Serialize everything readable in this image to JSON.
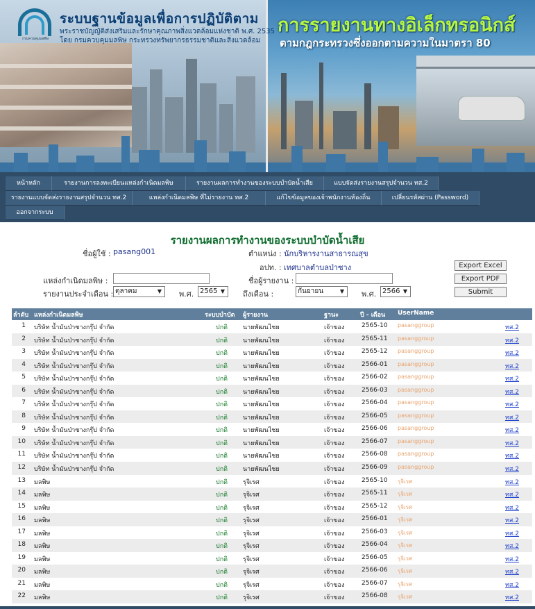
{
  "banner": {
    "org_title": "ระบบฐานข้อมูลเพื่อการปฏิบัติตาม",
    "org_sub1": "พระราชบัญญัติส่งเสริมและรักษาคุณภาพสิ่งแวดล้อมแห่งชาติ พ.ศ. 2535",
    "org_sub2": "โดย กรมควบคุมมลพิษ กระทรวงทรัพยากรธรรมชาติและสิ่งแวดล้อม",
    "logo_caption": "กรมควบคุมมลพิษ",
    "e_title": "การรายงานทางอิเล็กทรอนิกส์",
    "e_subtitle": "ตามกฎกระทรวงซึ่งออกตามความในมาตรา 80"
  },
  "menu": {
    "row1": [
      "หน้าหลัก",
      "รายงานการลงทะเบียนแหล่งกำเนิดมลพิษ",
      "รายงานผลการทำงานของระบบบำบัดน้ำเสีย",
      "แบบจัดส่งรายงานสรุปจำนวน ทส.2"
    ],
    "row2": [
      "รายงานแบบจัดส่งรายงานสรุปจำนวน ทส.2",
      "แหล่งกำเนิดมลพิษ ที่ไม่รายงาน ทส.2",
      "แก้ไขข้อมูลของเจ้าพนักงานท้องถิ่น",
      "เปลี่ยนรหัสผ่าน (Password)"
    ],
    "row3": [
      "ออกจากระบบ"
    ]
  },
  "report": {
    "title": "รายงานผลการทำงานของระบบบำบัดน้ำเสีย",
    "user_label": "ชื่อผู้ใช้ :",
    "user_value": "pasang001",
    "position_label": "ตำแหน่ง :",
    "position_value": "นักบริหารงานสาธารณสุข",
    "office_label": "อปท. :",
    "office_value": "เทศบาลตำบลป่าซาง",
    "source_label": "แหล่งกำเนิดมลพิษ :",
    "source_value": "",
    "reporter_label": "ชื่อผู้รายงาน :",
    "reporter_value": "",
    "month_from_label": "รายงานประจำเดือน :",
    "month_from_value": "ตุลาคม",
    "year_label": "พ.ศ.",
    "year_from_value": "2565",
    "month_to_label": "ถึงเดือน :",
    "month_to_value": "กันยายน",
    "year_to_value": "2566",
    "btn_excel": "Export Excel",
    "btn_pdf": "Export PDF",
    "btn_submit": "Submit"
  },
  "table": {
    "headers": [
      "ลำดับ",
      "แหล่งกำเนิดมลพิษ",
      "ระบบบำบัด",
      "ผู้รายงาน",
      "ฐานะ",
      "ปี - เดือน",
      "UserName"
    ],
    "rows": [
      [
        "1",
        "บริษัท น้ำมันป่าซางกรุ๊ป จำกัด",
        "ปกติ",
        "นายพัฒนไชย",
        "เจ้าของ",
        "2565-10",
        "pasanggroup",
        "ทส.2"
      ],
      [
        "2",
        "บริษัท น้ำมันป่าซางกรุ๊ป จำกัด",
        "ปกติ",
        "นายพัฒนไชย",
        "เจ้าของ",
        "2565-11",
        "pasanggroup",
        "ทส.2"
      ],
      [
        "3",
        "บริษัท น้ำมันป่าซางกรุ๊ป จำกัด",
        "ปกติ",
        "นายพัฒนไชย",
        "เจ้าของ",
        "2565-12",
        "pasanggroup",
        "ทส.2"
      ],
      [
        "4",
        "บริษัท น้ำมันป่าซางกรุ๊ป จำกัด",
        "ปกติ",
        "นายพัฒนไชย",
        "เจ้าของ",
        "2566-01",
        "pasanggroup",
        "ทส.2"
      ],
      [
        "5",
        "บริษัท น้ำมันป่าซางกรุ๊ป จำกัด",
        "ปกติ",
        "นายพัฒนไชย",
        "เจ้าของ",
        "2566-02",
        "pasanggroup",
        "ทส.2"
      ],
      [
        "6",
        "บริษัท น้ำมันป่าซางกรุ๊ป จำกัด",
        "ปกติ",
        "นายพัฒนไชย",
        "เจ้าของ",
        "2566-03",
        "pasanggroup",
        "ทส.2"
      ],
      [
        "7",
        "บริษัท น้ำมันป่าซางกรุ๊ป จำกัด",
        "ปกติ",
        "นายพัฒนไชย",
        "เจ้าของ",
        "2566-04",
        "pasanggroup",
        "ทส.2"
      ],
      [
        "8",
        "บริษัท น้ำมันป่าซางกรุ๊ป จำกัด",
        "ปกติ",
        "นายพัฒนไชย",
        "เจ้าของ",
        "2566-05",
        "pasanggroup",
        "ทส.2"
      ],
      [
        "9",
        "บริษัท น้ำมันป่าซางกรุ๊ป จำกัด",
        "ปกติ",
        "นายพัฒนไชย",
        "เจ้าของ",
        "2566-06",
        "pasanggroup",
        "ทส.2"
      ],
      [
        "10",
        "บริษัท น้ำมันป่าซางกรุ๊ป จำกัด",
        "ปกติ",
        "นายพัฒนไชย",
        "เจ้าของ",
        "2566-07",
        "pasanggroup",
        "ทส.2"
      ],
      [
        "11",
        "บริษัท น้ำมันป่าซางกรุ๊ป จำกัด",
        "ปกติ",
        "นายพัฒนไชย",
        "เจ้าของ",
        "2566-08",
        "pasanggroup",
        "ทส.2"
      ],
      [
        "12",
        "บริษัท น้ำมันป่าซางกรุ๊ป จำกัด",
        "ปกติ",
        "นายพัฒนไชย",
        "เจ้าของ",
        "2566-09",
        "pasanggroup",
        "ทส.2"
      ],
      [
        "13",
        "มลพิษ",
        "ปกติ",
        "รุจิเรศ",
        "เจ้าของ",
        "2565-10",
        "รุจิเรศ",
        "ทส.2"
      ],
      [
        "14",
        "มลพิษ",
        "ปกติ",
        "รุจิเรศ",
        "เจ้าของ",
        "2565-11",
        "รุจิเรศ",
        "ทส.2"
      ],
      [
        "15",
        "มลพิษ",
        "ปกติ",
        "รุจิเรศ",
        "เจ้าของ",
        "2565-12",
        "รุจิเรศ",
        "ทส.2"
      ],
      [
        "16",
        "มลพิษ",
        "ปกติ",
        "รุจิเรศ",
        "เจ้าของ",
        "2566-01",
        "รุจิเรศ",
        "ทส.2"
      ],
      [
        "17",
        "มลพิษ",
        "ปกติ",
        "รุจิเรศ",
        "เจ้าของ",
        "2566-03",
        "รุจิเรศ",
        "ทส.2"
      ],
      [
        "18",
        "มลพิษ",
        "ปกติ",
        "รุจิเรศ",
        "เจ้าของ",
        "2566-04",
        "รุจิเรศ",
        "ทส.2"
      ],
      [
        "19",
        "มลพิษ",
        "ปกติ",
        "รุจิเรศ",
        "เจ้าของ",
        "2566-05",
        "รุจิเรศ",
        "ทส.2"
      ],
      [
        "20",
        "มลพิษ",
        "ปกติ",
        "รุจิเรศ",
        "เจ้าของ",
        "2566-06",
        "รุจิเรศ",
        "ทส.2"
      ],
      [
        "21",
        "มลพิษ",
        "ปกติ",
        "รุจิเรศ",
        "เจ้าของ",
        "2566-07",
        "รุจิเรศ",
        "ทส.2"
      ],
      [
        "22",
        "มลพิษ",
        "ปกติ",
        "รุจิเรศ",
        "เจ้าของ",
        "2566-08",
        "รุจิเรศ",
        "ทส.2"
      ]
    ]
  },
  "colors": {
    "menu_bg": "#2f4b66",
    "table_header_bg": "#5f7f9c",
    "title_green": "#0c6b2c",
    "status_green": "#167b2a",
    "username_orange": "#e8a26b",
    "link_blue": "#1a3ecc"
  }
}
